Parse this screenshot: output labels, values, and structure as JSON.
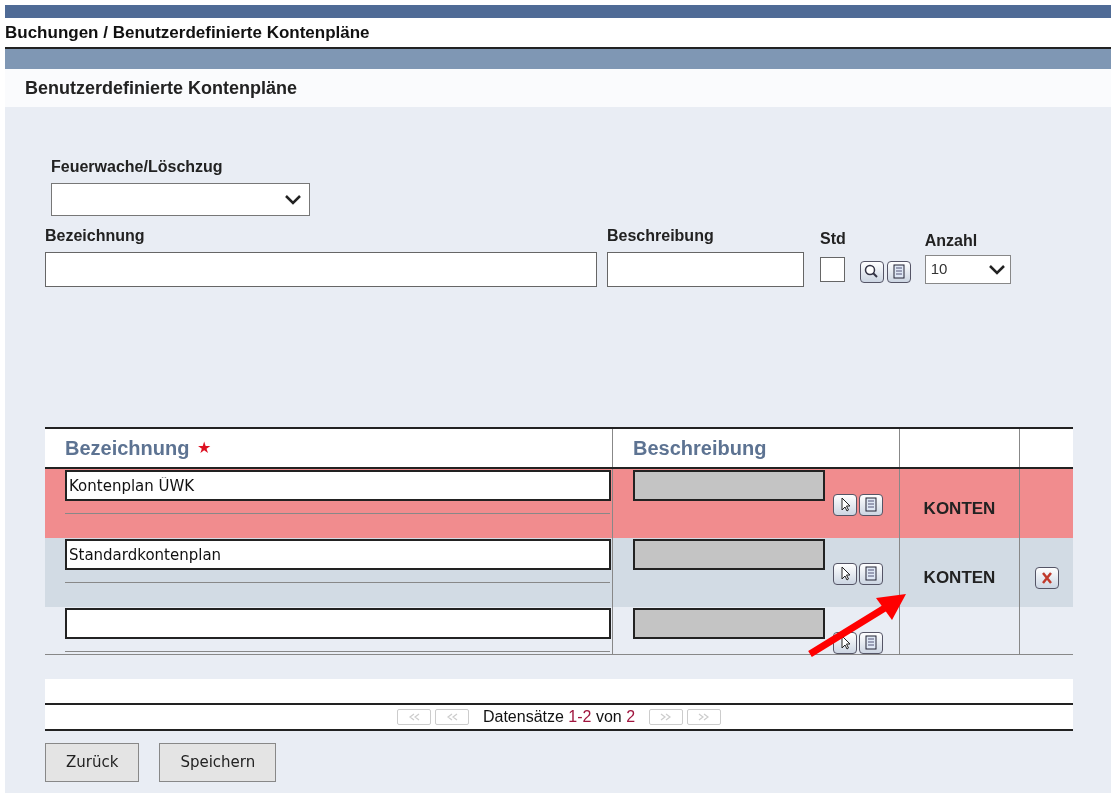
{
  "breadcrumb": "Buchungen / Benutzerdefinierte Kontenpläne",
  "page_title": "Benutzerdefinierte Kontenpläne",
  "filters": {
    "station": {
      "label": "Feuerwache/Löschzug"
    },
    "name": {
      "label": "Bezeichnung"
    },
    "description": {
      "label": "Beschreibung"
    },
    "std": {
      "label": "Std",
      "checked": false
    },
    "count": {
      "label": "Anzahl",
      "value": "10"
    }
  },
  "table": {
    "columns": [
      {
        "label": "Bezeichnung",
        "required_mark": "★"
      },
      {
        "label": "Beschreibung"
      }
    ],
    "rows": [
      {
        "name": "Kontenplan ÜWK",
        "selected": true,
        "link": "KONTEN",
        "deletable": false
      },
      {
        "name": "Standardkontenplan",
        "selected": false,
        "link": "KONTEN",
        "deletable": true
      },
      {
        "selected": false,
        "deletable": false
      }
    ]
  },
  "pager": {
    "label": "Datensätze",
    "range": "1-2",
    "of": "von",
    "total": "2",
    "has_previous": false,
    "has_next": false
  },
  "buttons": [
    "Zurück",
    "Speichern"
  ]
}
